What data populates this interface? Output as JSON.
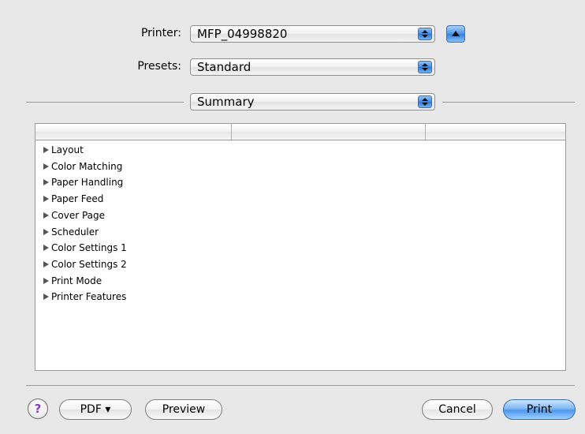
{
  "printer": {
    "label": "Printer:",
    "value": "MFP_04998820"
  },
  "presets": {
    "label": "Presets:",
    "value": "Standard"
  },
  "pane": {
    "value": "Summary"
  },
  "summary_items": [
    "Layout",
    "Color Matching",
    "Paper Handling",
    "Paper Feed",
    "Cover Page",
    "Scheduler",
    "Color Settings 1",
    "Color Settings 2",
    "Print Mode",
    "Printer Features"
  ],
  "buttons": {
    "help": "?",
    "pdf": "PDF ▾",
    "preview": "Preview",
    "cancel": "Cancel",
    "print": "Print"
  },
  "colors": {
    "default_button": "#4d97ec",
    "help_glyph": "#7e3fbf"
  }
}
